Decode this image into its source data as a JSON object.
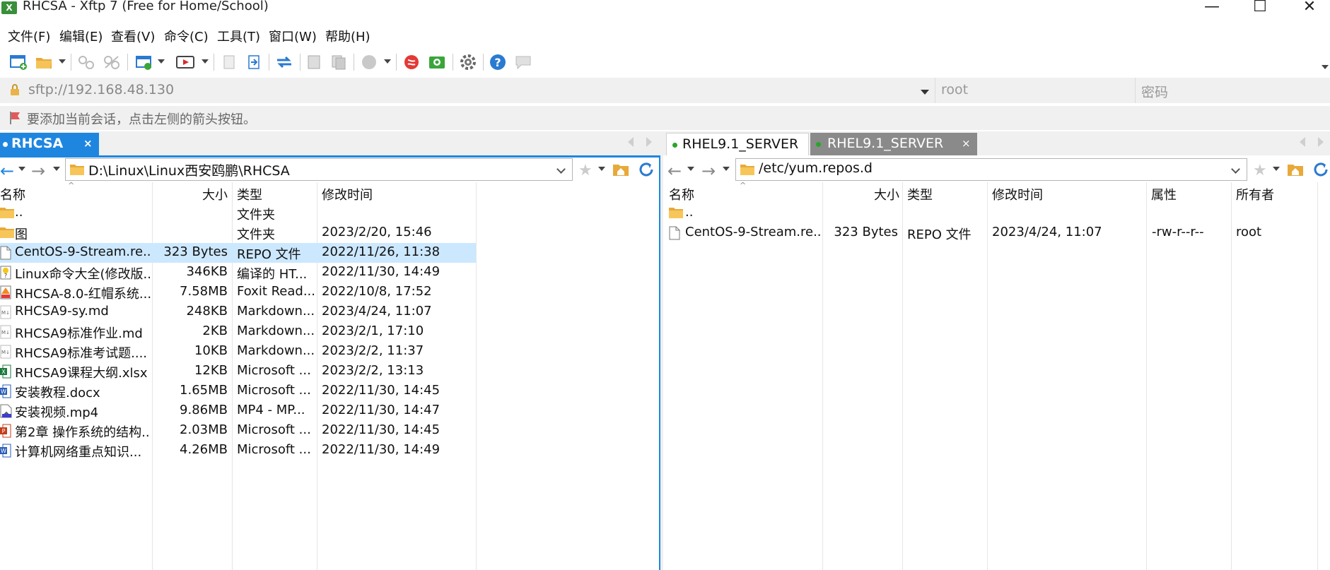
{
  "window": {
    "title": "RHCSA - Xftp 7 (Free for Home/School)",
    "minimize": "—",
    "maximize": "☐",
    "close": "✕"
  },
  "menu": {
    "items": [
      "文件(F)",
      "编辑(E)",
      "查看(V)",
      "命令(C)",
      "工具(T)",
      "窗口(W)",
      "帮助(H)"
    ]
  },
  "address": {
    "url": "sftp://192.168.48.130",
    "username_placeholder": "root",
    "password_placeholder": "密码"
  },
  "hint": {
    "text": "要添加当前会话，点击左侧的箭头按钮。"
  },
  "tabs": {
    "local": {
      "label": "RHCSA",
      "close": "×"
    },
    "remote": [
      {
        "label": "RHEL9.1_SERVER"
      },
      {
        "label": "RHEL9.1_SERVER",
        "close": "×"
      }
    ]
  },
  "local_pane": {
    "path": "D:\\Linux\\Linux西安鸥鹏\\RHCSA",
    "columns": [
      "名称",
      "大小",
      "类型",
      "修改时间"
    ],
    "rows": [
      {
        "name": "..",
        "size": "",
        "type": "文件夹",
        "modified": "",
        "icon": "folder-icon"
      },
      {
        "name": "图",
        "size": "",
        "type": "文件夹",
        "modified": "2023/2/20, 15:46",
        "icon": "folder-icon"
      },
      {
        "name": "CentOS-9-Stream.re...",
        "size": "323 Bytes",
        "type": "REPO 文件",
        "modified": "2022/11/26, 11:38",
        "icon": "file-icon",
        "selected": true
      },
      {
        "name": "Linux命令大全(修改版...",
        "size": "346KB",
        "type": "编译的 HT...",
        "modified": "2022/11/30, 14:49",
        "icon": "chm-icon"
      },
      {
        "name": "RHCSA-8.0-红帽系统...",
        "size": "7.58MB",
        "type": "Foxit Read...",
        "modified": "2022/10/8, 17:52",
        "icon": "pdf-icon"
      },
      {
        "name": "RHCSA9-sy.md",
        "size": "248KB",
        "type": "Markdown...",
        "modified": "2023/4/24, 11:07",
        "icon": "markdown-icon"
      },
      {
        "name": "RHCSA9标准作业.md",
        "size": "2KB",
        "type": "Markdown...",
        "modified": "2023/2/1, 17:10",
        "icon": "markdown-icon"
      },
      {
        "name": "RHCSA9标准考试题....",
        "size": "10KB",
        "type": "Markdown...",
        "modified": "2023/2/2, 11:37",
        "icon": "markdown-icon"
      },
      {
        "name": "RHCSA9课程大纲.xlsx",
        "size": "12KB",
        "type": "Microsoft ...",
        "modified": "2023/2/2, 13:13",
        "icon": "excel-icon"
      },
      {
        "name": "安装教程.docx",
        "size": "1.65MB",
        "type": "Microsoft ...",
        "modified": "2022/11/30, 14:45",
        "icon": "word-icon"
      },
      {
        "name": "安装视频.mp4",
        "size": "9.86MB",
        "type": "MP4 - MP...",
        "modified": "2022/11/30, 14:47",
        "icon": "video-icon"
      },
      {
        "name": "第2章 操作系统的结构...",
        "size": "2.03MB",
        "type": "Microsoft ...",
        "modified": "2022/11/30, 14:45",
        "icon": "powerpoint-icon"
      },
      {
        "name": "计算机网络重点知识...",
        "size": "4.26MB",
        "type": "Microsoft ...",
        "modified": "2022/11/30, 14:49",
        "icon": "word-icon"
      }
    ]
  },
  "remote_pane": {
    "path": "/etc/yum.repos.d",
    "columns": [
      "名称",
      "大小",
      "类型",
      "修改时间",
      "属性",
      "所有者"
    ],
    "rows": [
      {
        "name": "..",
        "size": "",
        "type": "",
        "modified": "",
        "attrs": "",
        "owner": "",
        "icon": "folder-icon"
      },
      {
        "name": "CentOS-9-Stream.re...",
        "size": "323 Bytes",
        "type": "REPO 文件",
        "modified": "2023/4/24, 11:07",
        "attrs": "-rw-r--r--",
        "owner": "root",
        "icon": "file-icon"
      }
    ]
  },
  "colors": {
    "accent": "#1f86e0",
    "selection": "#cce8ff",
    "active_tab_remote": "#8a8a8a"
  }
}
